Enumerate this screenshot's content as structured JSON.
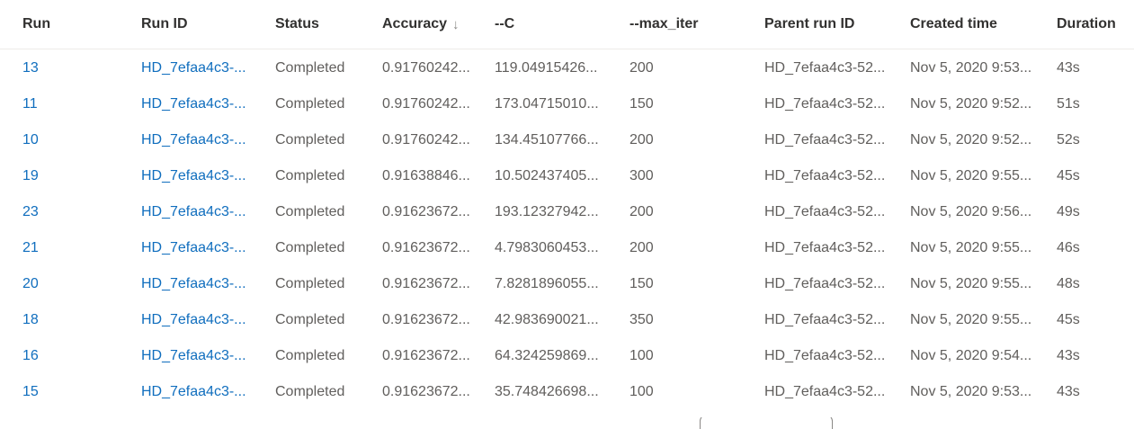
{
  "table": {
    "columns": {
      "run": "Run",
      "run_id": "Run ID",
      "status": "Status",
      "accuracy": "Accuracy",
      "accuracy_sort_icon": "↓",
      "c": "--C",
      "max_iter": "--max_iter",
      "parent_run_id": "Parent run ID",
      "created_time": "Created time",
      "duration": "Duration"
    },
    "rows": [
      {
        "run": "13",
        "run_id": "HD_7efaa4c3-...",
        "status": "Completed",
        "accuracy": "0.91760242...",
        "c": "119.04915426...",
        "max_iter": "200",
        "parent_run_id": "HD_7efaa4c3-52...",
        "created_time": "Nov 5, 2020 9:53...",
        "duration": "43s"
      },
      {
        "run": "11",
        "run_id": "HD_7efaa4c3-...",
        "status": "Completed",
        "accuracy": "0.91760242...",
        "c": "173.04715010...",
        "max_iter": "150",
        "parent_run_id": "HD_7efaa4c3-52...",
        "created_time": "Nov 5, 2020 9:52...",
        "duration": "51s"
      },
      {
        "run": "10",
        "run_id": "HD_7efaa4c3-...",
        "status": "Completed",
        "accuracy": "0.91760242...",
        "c": "134.45107766...",
        "max_iter": "200",
        "parent_run_id": "HD_7efaa4c3-52...",
        "created_time": "Nov 5, 2020 9:52...",
        "duration": "52s"
      },
      {
        "run": "19",
        "run_id": "HD_7efaa4c3-...",
        "status": "Completed",
        "accuracy": "0.91638846...",
        "c": "10.502437405...",
        "max_iter": "300",
        "parent_run_id": "HD_7efaa4c3-52...",
        "created_time": "Nov 5, 2020 9:55...",
        "duration": "45s"
      },
      {
        "run": "23",
        "run_id": "HD_7efaa4c3-...",
        "status": "Completed",
        "accuracy": "0.91623672...",
        "c": "193.12327942...",
        "max_iter": "200",
        "parent_run_id": "HD_7efaa4c3-52...",
        "created_time": "Nov 5, 2020 9:56...",
        "duration": "49s"
      },
      {
        "run": "21",
        "run_id": "HD_7efaa4c3-...",
        "status": "Completed",
        "accuracy": "0.91623672...",
        "c": "4.7983060453...",
        "max_iter": "200",
        "parent_run_id": "HD_7efaa4c3-52...",
        "created_time": "Nov 5, 2020 9:55...",
        "duration": "46s"
      },
      {
        "run": "20",
        "run_id": "HD_7efaa4c3-...",
        "status": "Completed",
        "accuracy": "0.91623672...",
        "c": "7.8281896055...",
        "max_iter": "150",
        "parent_run_id": "HD_7efaa4c3-52...",
        "created_time": "Nov 5, 2020 9:55...",
        "duration": "48s"
      },
      {
        "run": "18",
        "run_id": "HD_7efaa4c3-...",
        "status": "Completed",
        "accuracy": "0.91623672...",
        "c": "42.983690021...",
        "max_iter": "350",
        "parent_run_id": "HD_7efaa4c3-52...",
        "created_time": "Nov 5, 2020 9:55...",
        "duration": "45s"
      },
      {
        "run": "16",
        "run_id": "HD_7efaa4c3-...",
        "status": "Completed",
        "accuracy": "0.91623672...",
        "c": "64.324259869...",
        "max_iter": "100",
        "parent_run_id": "HD_7efaa4c3-52...",
        "created_time": "Nov 5, 2020 9:54...",
        "duration": "43s"
      },
      {
        "run": "15",
        "run_id": "HD_7efaa4c3-...",
        "status": "Completed",
        "accuracy": "0.91623672...",
        "c": "35.748426698...",
        "max_iter": "100",
        "parent_run_id": "HD_7efaa4c3-52...",
        "created_time": "Nov 5, 2020 9:53...",
        "duration": "43s"
      }
    ]
  },
  "colors": {
    "link": "#106ebe",
    "text": "#605e5c",
    "header": "#323130",
    "divider": "#edebe9"
  }
}
